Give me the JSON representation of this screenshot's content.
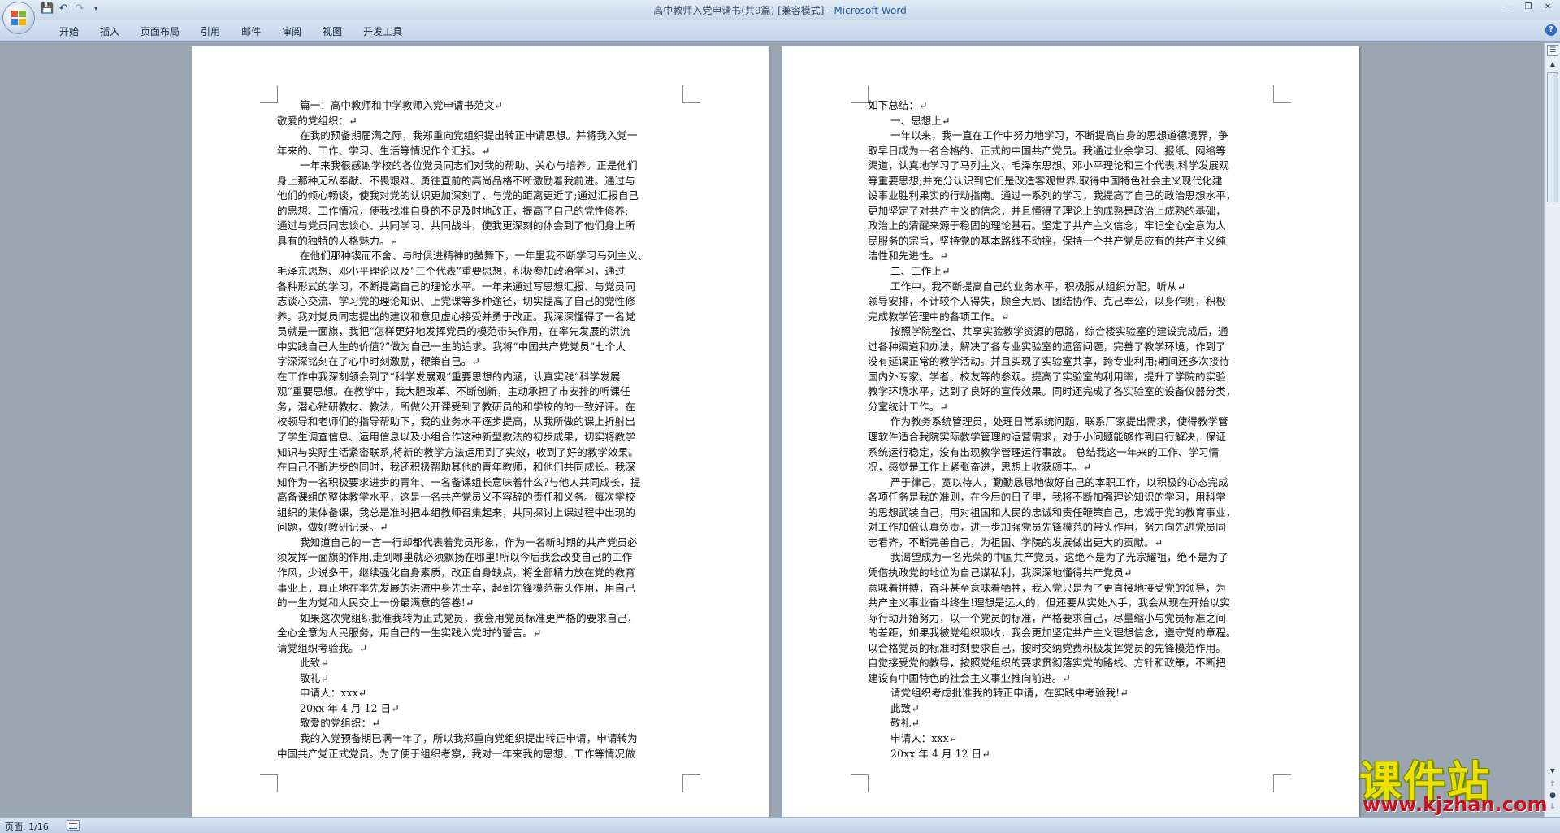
{
  "window": {
    "title": "高中教师入党申请书(共9篇) [兼容模式] - ",
    "app_name": "Microsoft Word"
  },
  "quick_access": {
    "icons": [
      "save-icon",
      "undo-icon",
      "redo-icon",
      "customize-icon"
    ]
  },
  "ribbon": {
    "tabs": [
      "开始",
      "插入",
      "页面布局",
      "引用",
      "邮件",
      "审阅",
      "视图",
      "开发工具"
    ]
  },
  "status": {
    "page": "页面: 1/16"
  },
  "watermark": {
    "cn": "课件站",
    "url": "www.kjzhan.com"
  },
  "pages": [
    {
      "lines": [
        {
          "t": "篇一：高中教师和中学教师入党申请书范文↵",
          "i": true
        },
        {
          "t": "敬爱的党组织：↵",
          "i": false
        },
        {
          "t": "在我的预备期届满之际，我郑重向党组织提出转正申请思想。并将我入党一",
          "i": true
        },
        {
          "t": "年来的、工作、学习、生活等情况作个汇报。↵",
          "i": false
        },
        {
          "t": "一年来我很感谢学校的各位党员同志们对我的帮助、关心与培养。正是他们",
          "i": true
        },
        {
          "t": "身上那种无私奉献、不畏艰难、勇往直前的高尚品格不断激励着我前进。通过与",
          "i": false
        },
        {
          "t": "他们的倾心畅谈，使我对党的认识更加深刻了、与党的距离更近了;通过汇报自己",
          "i": false
        },
        {
          "t": "的思想、工作情况，使我找准自身的不足及时地改正，提高了自己的党性修养;",
          "i": false
        },
        {
          "t": "通过与党员同志谈心、共同学习、共同战斗，使我更深刻的体会到了他们身上所",
          "i": false
        },
        {
          "t": "具有的独特的人格魅力。↵",
          "i": false
        },
        {
          "t": "在他们那种锲而不舍、与时俱进精神的鼓舞下，一年里我不断学习马列主义、",
          "i": true
        },
        {
          "t": "毛泽东思想、邓小平理论以及“三个代表”重要思想，积极参加政治学习，通过",
          "i": false
        },
        {
          "t": "各种形式的学习，不断提高自己的理论水平。一年来通过写思想汇报、与党员同",
          "i": false
        },
        {
          "t": "志谈心交流、学习党的理论知识、上党课等多种途径，切实提高了自己的党性修",
          "i": false
        },
        {
          "t": "养。我对党员同志提出的建议和意见虚心接受并勇于改正。我深深懂得了一名党",
          "i": false
        },
        {
          "t": "员就是一面旗，我把“怎样更好地发挥党员的模范带头作用，在率先发展的洪流",
          "i": false
        },
        {
          "t": "中实践自己人生的价值?”做为自己一生的追求。我将“中国共产党党员”七个大",
          "i": false
        },
        {
          "t": "字深深铭刻在了心中时刻激励，鞭策自己。↵",
          "i": false
        },
        {
          "t": "在工作中我深刻领会到了“科学发展观”重要思想的内涵，认真实践“科学发展",
          "i": false
        },
        {
          "t": "观”重要思想。在教学中，我大胆改革、不断创新，主动承担了市安排的听课任",
          "i": false
        },
        {
          "t": "务，潜心钻研教材、教法，所做公开课受到了教研员的和学校的的一致好评。在",
          "i": false
        },
        {
          "t": "校领导和老师们的指导帮助下，我的业务水平逐步提高，从我所做的课上折射出",
          "i": false
        },
        {
          "t": "了学生调查信息、运用信息以及小组合作这种新型教法的初步成果，切实将教学",
          "i": false
        },
        {
          "t": "知识与实际生活紧密联系,将新的教学方法运用到了实效，收到了好的教学效果。",
          "i": false
        },
        {
          "t": "在自己不断进步的同时，我还积极帮助其他的青年教师，和他们共同成长。我深",
          "i": false
        },
        {
          "t": "知作为一名积极要求进步的青年、一名备课组长意味着什么?与他人共同成长，提",
          "i": false
        },
        {
          "t": "高备课组的整体教学水平，这是一名共产党员义不容辞的责任和义务。每次学校",
          "i": false
        },
        {
          "t": "组织的集体备课，我总是准时把本组教师召集起来，共同探讨上课过程中出现的",
          "i": false
        },
        {
          "t": "问题，做好教研记录。↵",
          "i": false
        },
        {
          "t": "我知道自己的一言一行却都代表着党员形象，作为一名新时期的共产党员必",
          "i": true
        },
        {
          "t": "须发挥一面旗的作用,走到哪里就必须飘扬在哪里!所以今后我会改变自己的工作",
          "i": false
        },
        {
          "t": "作风，少说多干，继续强化自身素质，改正自身缺点，将全部精力放在党的教育",
          "i": false
        },
        {
          "t": "事业上，真正地在率先发展的洪流中身先士卒，起到先锋模范带头作用，用自己",
          "i": false
        },
        {
          "t": "的一生为党和人民交上一份最满意的答卷!↵",
          "i": false
        },
        {
          "t": "如果这次党组织批准我转为正式党员，我会用党员标准更严格的要求自己，",
          "i": true
        },
        {
          "t": "全心全意为人民服务，用自己的一生实践入党时的誓言。↵",
          "i": false
        },
        {
          "t": "请党组织考验我。↵",
          "i": false
        },
        {
          "t": "此致↵",
          "i": true
        },
        {
          "t": "敬礼↵",
          "i": true
        },
        {
          "t": "申请人：xxx↵",
          "i": true
        },
        {
          "t": "20xx 年 4 月 12 日↵",
          "i": true
        },
        {
          "t": "敬爱的党组织：↵",
          "i": true
        },
        {
          "t": "我的入党预备期已满一年了，所以我郑重向党组织提出转正申请，申请转为",
          "i": true
        },
        {
          "t": "中国共产党正式党员。为了便于组织考察，我对一年来我的思想、工作等情况做",
          "i": false
        }
      ]
    },
    {
      "lines": [
        {
          "t": "如下总结：↵",
          "i": false
        },
        {
          "t": "一、思想上↵",
          "i": true
        },
        {
          "t": "一年以来，我一直在工作中努力地学习，不断提高自身的思想道德境界，争",
          "i": true
        },
        {
          "t": "取早日成为一名合格的、正式的中国共产党员。我通过业余学习、报纸、网络等",
          "i": false
        },
        {
          "t": "渠道，认真地学习了马列主义、毛泽东思想、邓小平理论和三个代表,科学发展观",
          "i": false
        },
        {
          "t": "等重要思想;并充分认识到它们是改造客观世界,取得中国特色社会主义现代化建",
          "i": false
        },
        {
          "t": "设事业胜利果实的行动指南。通过一系列的学习，我提高了自己的政治思想水平，",
          "i": false
        },
        {
          "t": "更加坚定了对共产主义的信念，并且懂得了理论上的成熟是政治上成熟的基础，",
          "i": false
        },
        {
          "t": "政治上的清醒来源于稳固的理论基石。坚定了共产主义信念，牢记全心全意为人",
          "i": false
        },
        {
          "t": "民服务的宗旨，坚持党的基本路线不动摇，保持一个共产党员应有的共产主义纯",
          "i": false
        },
        {
          "t": "洁性和先进性。↵",
          "i": false
        },
        {
          "t": "二、工作上↵",
          "i": true
        },
        {
          "t": "工作中，我不断提高自己的业务水平，积极服从组织分配，听从↵",
          "i": true
        },
        {
          "t": "领导安排，不计较个人得失，顾全大局、团结协作、克己奉公，以身作则，积极",
          "i": false
        },
        {
          "t": "完成教学管理中的各项工作。↵",
          "i": false
        },
        {
          "t": "按照学院整合、共享实验教学资源的思路，综合楼实验室的建设完成后，通",
          "i": true
        },
        {
          "t": "过各种渠道和办法，解决了各专业实验室的遗留问题，完善了教学环境，作到了",
          "i": false
        },
        {
          "t": "没有延误正常的教学活动。并且实现了实验室共享，跨专业利用;期间还多次接待",
          "i": false
        },
        {
          "t": "国内外专家、学者、校友等的参观。提高了实验室的利用率，提升了学院的实验",
          "i": false
        },
        {
          "t": "教学环境水平，达到了良好的宣传效果。同时还完成了各实验室的设备仪器分类，",
          "i": false
        },
        {
          "t": "分室统计工作。↵",
          "i": false
        },
        {
          "t": "作为教务系统管理员，处理日常系统问题，联系厂家提出需求，使得教学管",
          "i": true
        },
        {
          "t": "理软件适合我院实际教学管理的运营需求，对于小问题能够作到自行解决，保证",
          "i": false
        },
        {
          "t": "系统运行稳定，没有出现教学管理运行事故。    总结我这一年来的工作、学习情",
          "i": false
        },
        {
          "t": "况，感觉是工作上紧张奋进，思想上收获颇丰。↵",
          "i": false
        },
        {
          "t": "严于律己，宽以待人，勤勤恳恳地做好自己的本职工作，以积极的心态完成",
          "i": true
        },
        {
          "t": "各项任务是我的准则，在今后的日子里，我将不断加强理论知识的学习，用科学",
          "i": false
        },
        {
          "t": "的思想武装自己，用对祖国和人民的忠诚和责任鞭策自己，忠诚于党的教育事业，",
          "i": false
        },
        {
          "t": "对工作加倍认真负责，进一步加强党员先锋模范的带头作用，努力向先进党员同",
          "i": false
        },
        {
          "t": "志看齐，不断完善自己，为祖国、学院的发展做出更大的贡献。↵",
          "i": false
        },
        {
          "t": "我渴望成为一名光荣的中国共产党员，这绝不是为了光宗耀祖，绝不是为了",
          "i": true
        },
        {
          "t": "凭借执政党的地位为自己谋私利，我深深地懂得共产党员↵",
          "i": false
        },
        {
          "t": "意味着拼搏，奋斗甚至意味着牺牲，我入党只是为了更直接地接受党的领导，为",
          "i": false
        },
        {
          "t": "共产主义事业奋斗终生!理想是远大的，但还要从实处入手，我会从现在开始以实",
          "i": false
        },
        {
          "t": "际行动开始努力，以一个党员的标准，严格要求自己，尽量缩小与党员标准之间",
          "i": false
        },
        {
          "t": "的差距，如果我被党组织吸收，我会更加坚定共产主义理想信念，遵守党的章程。",
          "i": false
        },
        {
          "t": "以合格党员的标准时刻要求自己，按时交纳党费积极发挥党员的先锋模范作用。",
          "i": false
        },
        {
          "t": "自觉接受党的教导，按照党组织的要求贯彻落实党的路线、方针和政策，不断把",
          "i": false
        },
        {
          "t": "建设有中国特色的社会主义事业推向前进。↵",
          "i": false
        },
        {
          "t": "请党组织考虑批准我的转正申请，在实践中考验我!↵",
          "i": true
        },
        {
          "t": "此致↵",
          "i": true
        },
        {
          "t": "敬礼↵",
          "i": true
        },
        {
          "t": "申请人：xxx↵",
          "i": true
        },
        {
          "t": "20xx 年 4 月 12 日↵",
          "i": true
        }
      ]
    }
  ]
}
